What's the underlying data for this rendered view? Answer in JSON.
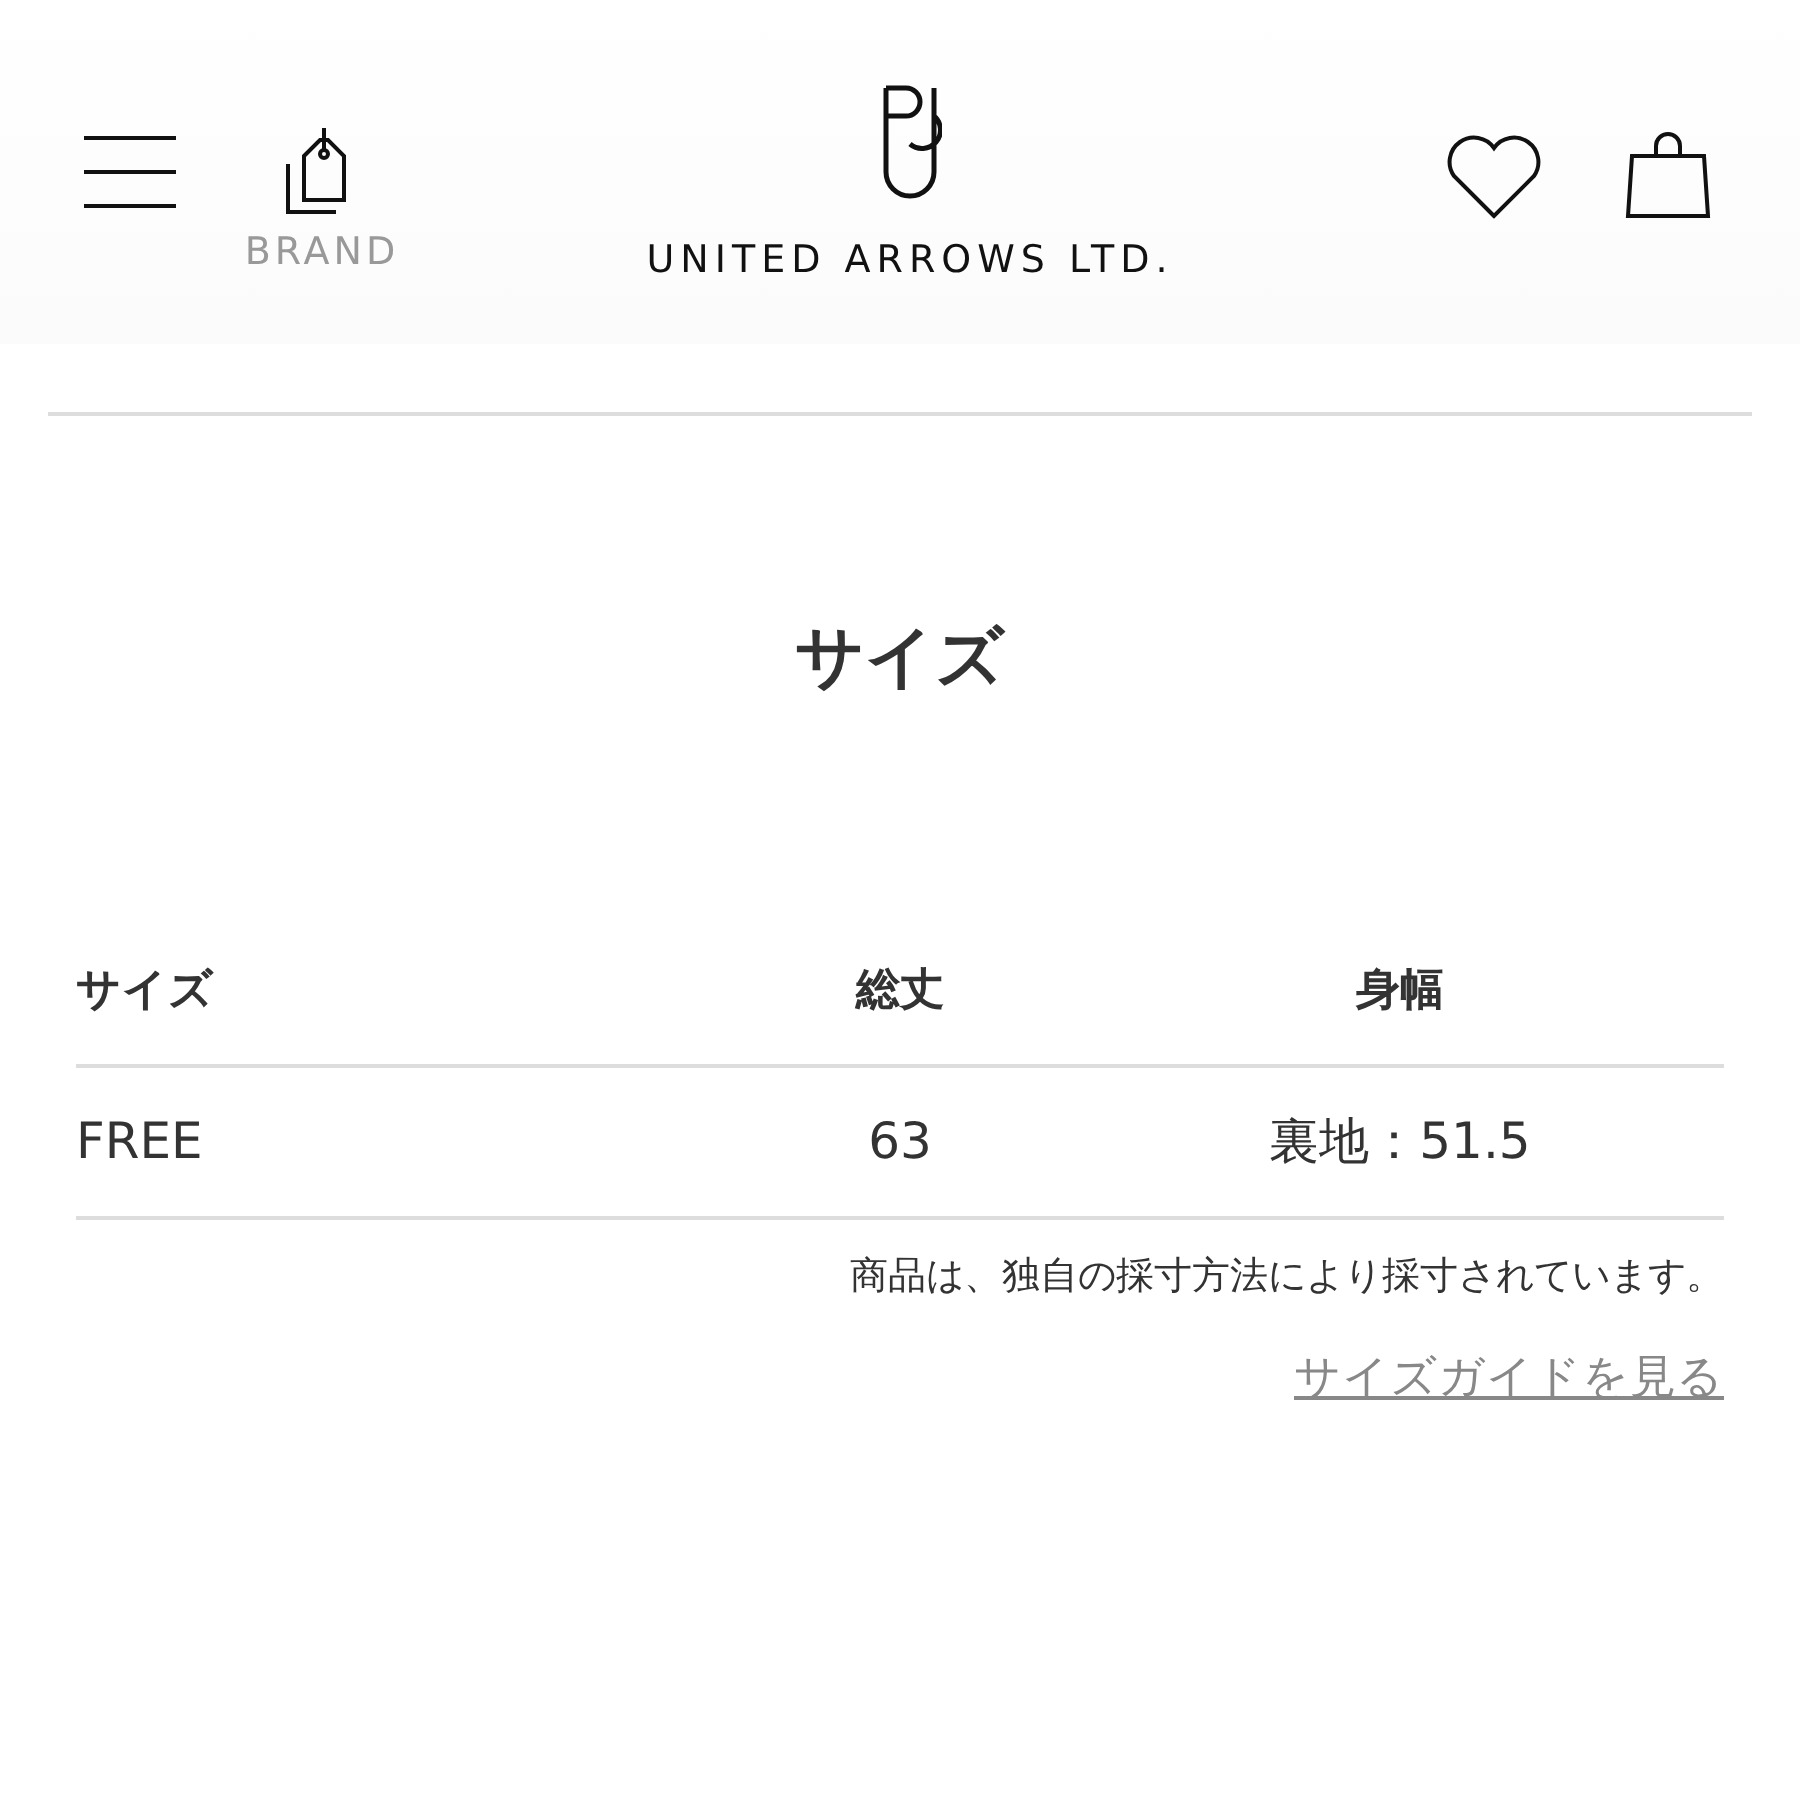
{
  "header": {
    "brand_label": "BRAND",
    "logo_text": "UNITED ARROWS LTD."
  },
  "section": {
    "title": "サイズ"
  },
  "table": {
    "columns": [
      "サイズ",
      "総丈",
      "身幅"
    ],
    "rows": [
      [
        "FREE",
        "63",
        "裏地：51.5"
      ]
    ]
  },
  "note": "商品は、独自の採寸方法により採寸されています。",
  "guide_link": "サイズガイドを見る"
}
